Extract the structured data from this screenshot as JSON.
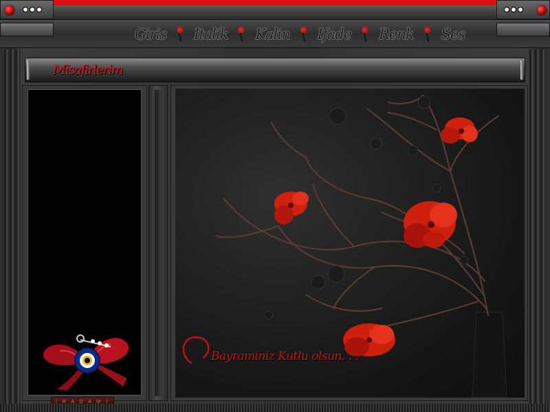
{
  "window": {
    "accent_color": "#e01010",
    "control_icons": [
      "red-orb-icon",
      "dots-icon"
    ]
  },
  "menu": {
    "items": [
      {
        "label": "Giris"
      },
      {
        "label": "Italik"
      },
      {
        "label": "Kalin"
      },
      {
        "label": "Ifade"
      },
      {
        "label": "Renk"
      },
      {
        "label": "Ses"
      }
    ],
    "separator_icon": "red-flower-icon"
  },
  "header": {
    "title": "Misafirlerim",
    "title_color": "#d11313"
  },
  "sidebar": {
    "decoration_icon": "evil-eye-bow-icon",
    "brand_label": "İ R A D A M I"
  },
  "main": {
    "image_subject": "red-flowers-branches-image",
    "greeting": "Bayraminiz Kutlu olsun. . ."
  }
}
